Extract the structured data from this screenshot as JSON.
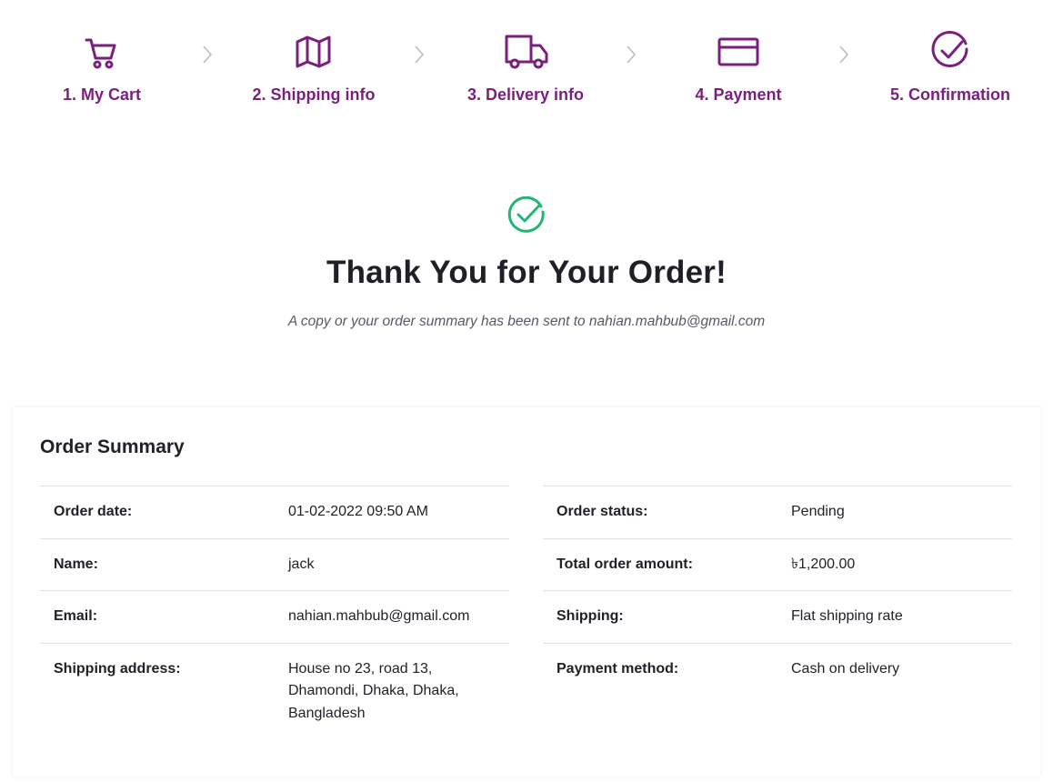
{
  "steps": [
    {
      "label": "1. My Cart",
      "icon": "cart-icon"
    },
    {
      "label": "2. Shipping info",
      "icon": "map-icon"
    },
    {
      "label": "3. Delivery info",
      "icon": "truck-icon"
    },
    {
      "label": "4. Payment",
      "icon": "credit-card-icon"
    },
    {
      "label": "5. Confirmation",
      "icon": "check-circle-icon"
    }
  ],
  "colors": {
    "accent": "#7b1f7e",
    "success": "#22b573",
    "divider": "#dfe1e6"
  },
  "confirmation": {
    "icon": "check-circle-icon",
    "title": "Thank You for Your Order!",
    "subtitle": "A copy or your order summary has been sent to nahian.mahbub@gmail.com"
  },
  "summary": {
    "title": "Order Summary",
    "left": [
      {
        "key": "Order date:",
        "value": "01-02-2022 09:50 AM"
      },
      {
        "key": "Name:",
        "value": "jack"
      },
      {
        "key": "Email:",
        "value": "nahian.mahbub@gmail.com"
      },
      {
        "key": "Shipping address:",
        "value_lines": [
          "House no 23, road 13,",
          "Dhamondi, Dhaka, Dhaka,",
          "Bangladesh"
        ]
      }
    ],
    "right": [
      {
        "key": "Order status:",
        "value": "Pending"
      },
      {
        "key": "Total order amount:",
        "value": "৳1,200.00"
      },
      {
        "key": "Shipping:",
        "value": "Flat shipping rate"
      },
      {
        "key": "Payment method:",
        "value": "Cash on delivery"
      }
    ]
  }
}
